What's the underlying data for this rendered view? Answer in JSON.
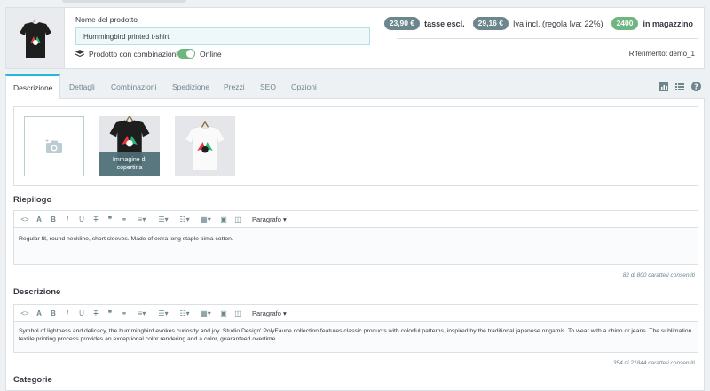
{
  "product": {
    "name_label": "Nome del prodotto",
    "name_value": "Hummingbird printed t-shirt",
    "combinations_label": "Prodotto con combinazioni",
    "online_label": "Online",
    "online": true
  },
  "prices": {
    "tax_excl_value": "23,90 €",
    "tax_excl_label": "tasse escl.",
    "tax_incl_value": "29,16 €",
    "tax_incl_label": "Iva incl. (regola Iva: 22%)",
    "stock_value": "2400",
    "stock_label": "in magazzino",
    "reference": "Riferimento: demo_1"
  },
  "tabs": [
    "Descrizione",
    "Dettagli",
    "Combinazioni",
    "Spedizione",
    "Prezzi",
    "SEO",
    "Opzioni"
  ],
  "images": {
    "cover_caption": "Immagine di copertina"
  },
  "summary": {
    "title": "Riepilogo",
    "paragraph_select": "Paragrafo",
    "text": "Regular fit, round neckline, short sleeves. Made of extra long staple pima cotton.",
    "counter": "82 di 800 caratteri consentiti"
  },
  "description": {
    "title": "Descrizione",
    "paragraph_select": "Paragrafo",
    "text": "Symbol of lightness and delicacy, the hummingbird evokes curiosity and joy. Studio Design' PolyFaune collection features classic products with colorful patterns, inspired by the traditional japanese origamis. To wear with a chino or jeans. The sublimation textile printing process provides an exceptional color rendering and a color, guaranteed overtime.",
    "counter": "354 di 21844 caratteri consentiti"
  },
  "categories": {
    "title": "Categorie"
  },
  "colors": {
    "accent": "#25b9d7",
    "success": "#70b580",
    "badge_dark": "#6c868e"
  }
}
